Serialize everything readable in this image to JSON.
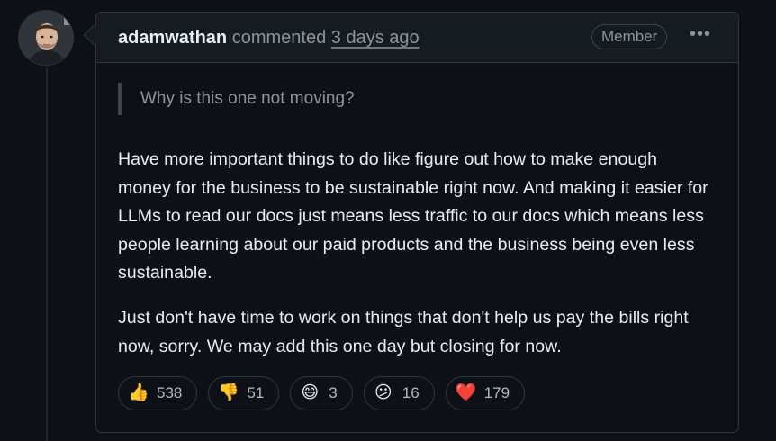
{
  "comment": {
    "author": "adamwathan",
    "action": "commented",
    "timestamp": "3 days ago",
    "badge": "Member",
    "more_label": "•••",
    "quote": "Why is this one not moving?",
    "paragraphs": [
      "Have more important things to do like figure out how to make enough money for the business to be sustainable right now. And making it easier for LLMs to read our docs just means less traffic to our docs which means less people learning about our paid products and the business being even less sustainable.",
      "Just don't have time to work on things that don't help us pay the bills right now, sorry. We may add this one day but closing for now."
    ]
  },
  "reactions": [
    {
      "icon": "thumbs-up-icon",
      "emoji": "👍",
      "count": "538"
    },
    {
      "icon": "thumbs-down-icon",
      "emoji": "👎",
      "count": "51"
    },
    {
      "icon": "laugh-icon",
      "emoji": "😄",
      "count": "3"
    },
    {
      "icon": "confused-icon",
      "emoji": "😕",
      "count": "16"
    },
    {
      "icon": "heart-icon",
      "emoji": "❤️",
      "count": "179"
    }
  ],
  "colors": {
    "background": "#0d1117",
    "header_background": "#161b22",
    "border": "#30363d",
    "text": "#e6edf3",
    "muted_text": "#8b949e"
  }
}
